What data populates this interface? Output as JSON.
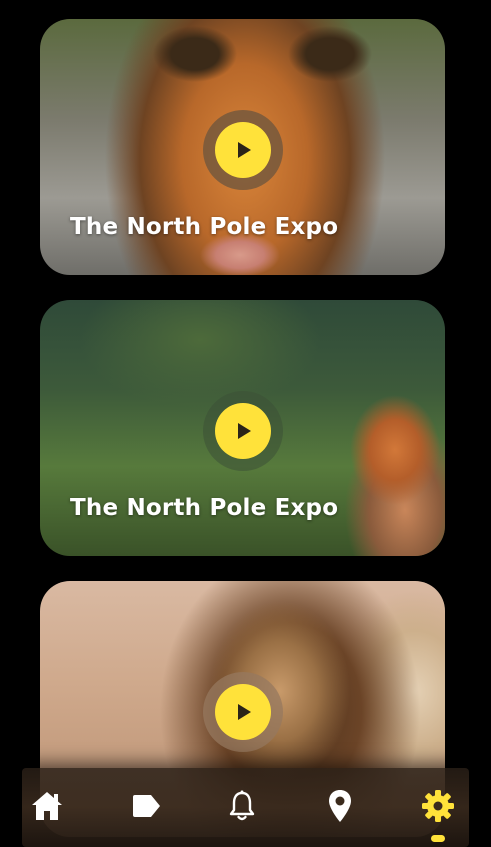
{
  "colors": {
    "background": "#000000",
    "accent": "#ffe23a",
    "title_text": "#ffffff",
    "nav_icon": "#ffffff"
  },
  "cards": [
    {
      "title": "The North Pole Expo",
      "subject": "tiger",
      "action_icon": "play-icon"
    },
    {
      "title": "The North Pole Expo",
      "subject": "fox",
      "action_icon": "play-icon"
    },
    {
      "title": "",
      "subject": "lion",
      "action_icon": "play-icon"
    }
  ],
  "bottom_nav": {
    "items": [
      {
        "icon": "home-icon",
        "active": false
      },
      {
        "icon": "tag-icon",
        "active": false
      },
      {
        "icon": "bell-icon",
        "active": false
      },
      {
        "icon": "location-pin-icon",
        "active": false
      },
      {
        "icon": "gear-icon",
        "active": true
      }
    ]
  }
}
